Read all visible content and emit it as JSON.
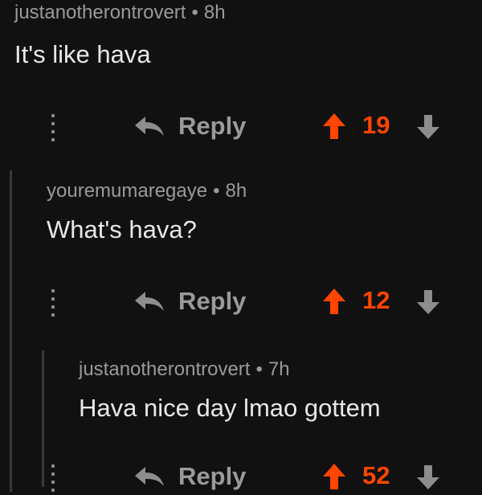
{
  "colors": {
    "background": "#111111",
    "upvote_accent": "#ff4500",
    "muted_text": "#9a9a9a",
    "body_text": "#e8e8e8"
  },
  "icons": {
    "more": "vertical-ellipsis-icon",
    "reply": "reply-arrow-icon",
    "upvote": "upvote-arrow-icon",
    "downvote": "downvote-arrow-icon"
  },
  "comments": [
    {
      "author": "justanotherontrovert",
      "separator": "•",
      "time": "8h",
      "text": "It's like hava",
      "reply_label": "Reply",
      "score": "19"
    },
    {
      "author": "youremumaregaye",
      "separator": "•",
      "time": "8h",
      "text": "What's hava?",
      "reply_label": "Reply",
      "score": "12"
    },
    {
      "author": "justanotherontrovert",
      "separator": "•",
      "time": "7h",
      "text": "Hava nice day lmao gottem",
      "reply_label": "Reply",
      "score": "52"
    }
  ]
}
